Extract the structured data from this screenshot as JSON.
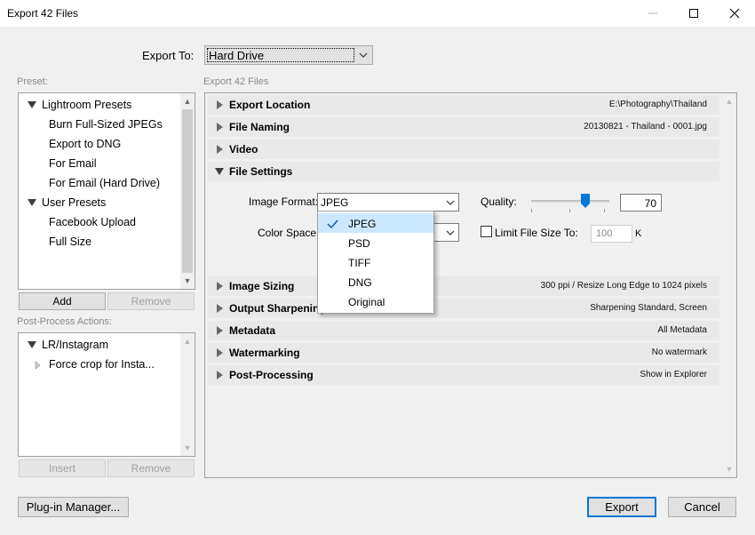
{
  "window": {
    "title": "Export 42 Files"
  },
  "export_to": {
    "label": "Export To:",
    "value": "Hard Drive"
  },
  "preset": {
    "label": "Preset:",
    "items": [
      {
        "label": "Lightroom Presets"
      },
      {
        "label": "Burn Full-Sized JPEGs"
      },
      {
        "label": "Export to DNG"
      },
      {
        "label": "For Email"
      },
      {
        "label": "For Email (Hard Drive)"
      },
      {
        "label": "User Presets"
      },
      {
        "label": "Facebook Upload"
      },
      {
        "label": "Full Size"
      }
    ],
    "add_label": "Add",
    "remove_label": "Remove"
  },
  "post_process": {
    "label": "Post-Process Actions:",
    "items": [
      {
        "label": "LR/Instagram"
      },
      {
        "label": "Force crop for Insta..."
      }
    ],
    "insert_label": "Insert",
    "remove_label": "Remove"
  },
  "main": {
    "header": "Export 42 Files",
    "sections": [
      {
        "title": "Export Location",
        "summary": "E:\\Photography\\Thailand"
      },
      {
        "title": "File Naming",
        "summary": "20130821 - Thailand - 0001.jpg"
      },
      {
        "title": "Video",
        "summary": ""
      },
      {
        "title": "File Settings",
        "summary": ""
      },
      {
        "title": "Image Sizing",
        "summary": "300 ppi / Resize Long Edge to 1024 pixels"
      },
      {
        "title": "Output Sharpening",
        "summary": "Sharpening Standard, Screen"
      },
      {
        "title": "Metadata",
        "summary": "All Metadata"
      },
      {
        "title": "Watermarking",
        "summary": "No watermark"
      },
      {
        "title": "Post-Processing",
        "summary": "Show in Explorer"
      }
    ],
    "file_settings": {
      "image_format_label": "Image Format:",
      "image_format_value": "JPEG",
      "color_space_label": "Color Space:",
      "quality_label": "Quality:",
      "quality_value": "70",
      "quality_fraction": 0.7,
      "limit_label": "Limit File Size To:",
      "limit_value": "100",
      "limit_unit": "K",
      "format_options": [
        "JPEG",
        "PSD",
        "TIFF",
        "DNG",
        "Original"
      ],
      "selected_option": "JPEG"
    }
  },
  "footer": {
    "plugin_manager_label": "Plug-in Manager...",
    "export_label": "Export",
    "cancel_label": "Cancel"
  },
  "colors": {
    "accent": "#0078d7",
    "selection": "#cce8ff",
    "section_bg": "#e9e9e9"
  }
}
